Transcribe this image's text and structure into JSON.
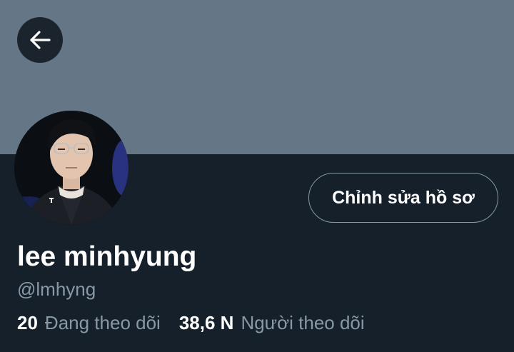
{
  "header": {
    "back_icon": "arrow-left-icon"
  },
  "profile": {
    "edit_button_label": "Chỉnh sửa hồ sơ",
    "display_name": "lee minhyung",
    "handle": "@lmhyng",
    "following_count": "20",
    "following_label": "Đang theo dõi",
    "followers_count": "38,6 N",
    "followers_label": "Người theo dõi"
  },
  "colors": {
    "background": "#15202b",
    "banner": "#657786",
    "secondary_text": "#8899a6",
    "primary_text": "#ffffff"
  }
}
